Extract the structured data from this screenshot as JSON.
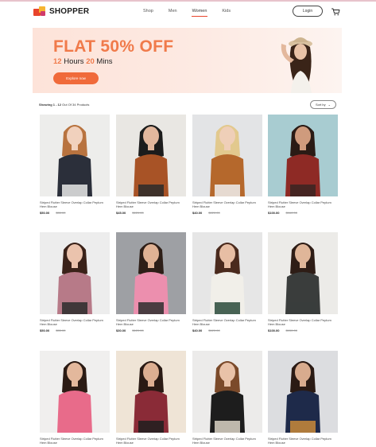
{
  "brand": {
    "name": "SHOPPER"
  },
  "nav": {
    "items": [
      "Shop",
      "Men",
      "Women",
      "Kids"
    ],
    "active_index": 2
  },
  "header": {
    "login_label": "Login"
  },
  "banner": {
    "title": "FLAT 50% OFF",
    "hours": "12",
    "hours_word": "Hours",
    "mins": "20",
    "mins_word": "Mins",
    "cta_label": "Explore now"
  },
  "results": {
    "label": "Showing 1 - 12",
    "suffix": "Out Of 34 Products"
  },
  "sort": {
    "label": "Sort by"
  },
  "products": [
    {
      "name": "Striped Flutter Sleeve Overlap Collar Peplum Hem Blouse",
      "price": "$50.00",
      "old_price": "$55.00",
      "bg": "#ededeb",
      "top": "#2b2f3a",
      "skin": "#f1d1bd",
      "hair": "#b8733f",
      "bottom": "#e8e8e8"
    },
    {
      "name": "Striped Flutter Sleeve Overlap Collar Peplum Hem Blouse",
      "price": "$45.00",
      "old_price": "$120.00",
      "bg": "#e9e7e3",
      "top": "#a85326",
      "skin": "#e2b79d",
      "hair": "#1c1c1c",
      "bottom": "#2c2c2c"
    },
    {
      "name": "Striped Flutter Sleeve Overlap Collar Peplum Hem Blouse",
      "price": "$40.00",
      "old_price": "$120.00",
      "bg": "#e3e4e6",
      "top": "#b5682c",
      "skin": "#efcfb8",
      "hair": "#e2c98e",
      "bottom": "#eeeeee"
    },
    {
      "name": "Striped Flutter Sleeve Overlap Collar Peplum Hem Blouse",
      "price": "$100.00",
      "old_price": "$160.00",
      "bg": "#a8ccd1",
      "top": "#8e2a25",
      "skin": "#cf9b7d",
      "hair": "#2a1b15",
      "bottom": "#3a2522"
    },
    {
      "name": "Striped Flutter Sleeve Overlap Collar Peplum Hem Blouse",
      "price": "$50.00",
      "old_price": "$55.00",
      "bg": "#ededed",
      "top": "#b77a88",
      "skin": "#ebc3ad",
      "hair": "#3a2219",
      "bottom": "#2b2b2b"
    },
    {
      "name": "Striped Flutter Sleeve Overlap Collar Peplum Hem Blouse",
      "price": "$30.00",
      "old_price": "$120.00",
      "bg": "#9ea0a4",
      "top": "#ec8fae",
      "skin": "#e0b294",
      "hair": "#2d1e17",
      "bottom": "#2e2e2e"
    },
    {
      "name": "Striped Flutter Sleeve Overlap Collar Peplum Hem Blouse",
      "price": "$40.00",
      "old_price": "$120.00",
      "bg": "#e6e6e6",
      "top": "#f1efe9",
      "skin": "#e7bea4",
      "hair": "#4a2a1d",
      "bottom": "#2a4a3a"
    },
    {
      "name": "Striped Flutter Sleeve Overlap Collar Peplum Hem Blouse",
      "price": "$100.00",
      "old_price": "$150.00",
      "bg": "#ecebe8",
      "top": "#3a3d3c",
      "skin": "#e0b699",
      "hair": "#2e1d16",
      "bottom": "#3a3d3c"
    },
    {
      "name": "Striped Flutter Sleeve Overlap Collar Peplum Hem Blouse",
      "price": "",
      "old_price": "",
      "bg": "#f0efee",
      "top": "#e86b8a",
      "skin": "#e3b89c",
      "hair": "#2b1b14",
      "bottom": "#e86b8a"
    },
    {
      "name": "Striped Flutter Sleeve Overlap Collar Peplum Hem Blouse",
      "price": "",
      "old_price": "",
      "bg": "#efe4d6",
      "top": "#8a2b37",
      "skin": "#dcae91",
      "hair": "#2a1a14",
      "bottom": "#1f1f1f"
    },
    {
      "name": "Striped Flutter Sleeve Overlap Collar Peplum Hem Blouse",
      "price": "",
      "old_price": "",
      "bg": "#ecebea",
      "top": "#1d1d1d",
      "skin": "#e9c2a8",
      "hair": "#7b4a2a",
      "bottom": "#dbd3c6"
    },
    {
      "name": "Striped Flutter Sleeve Overlap Collar Peplum Hem Blouse",
      "price": "",
      "old_price": "",
      "bg": "#dcdde0",
      "top": "#1e2a4a",
      "skin": "#d8ab8e",
      "hair": "#2a1a14",
      "bottom": "#c98a3a"
    }
  ],
  "colors": {
    "accent": "#f07a4a",
    "nav_underline": "#e8452c"
  }
}
